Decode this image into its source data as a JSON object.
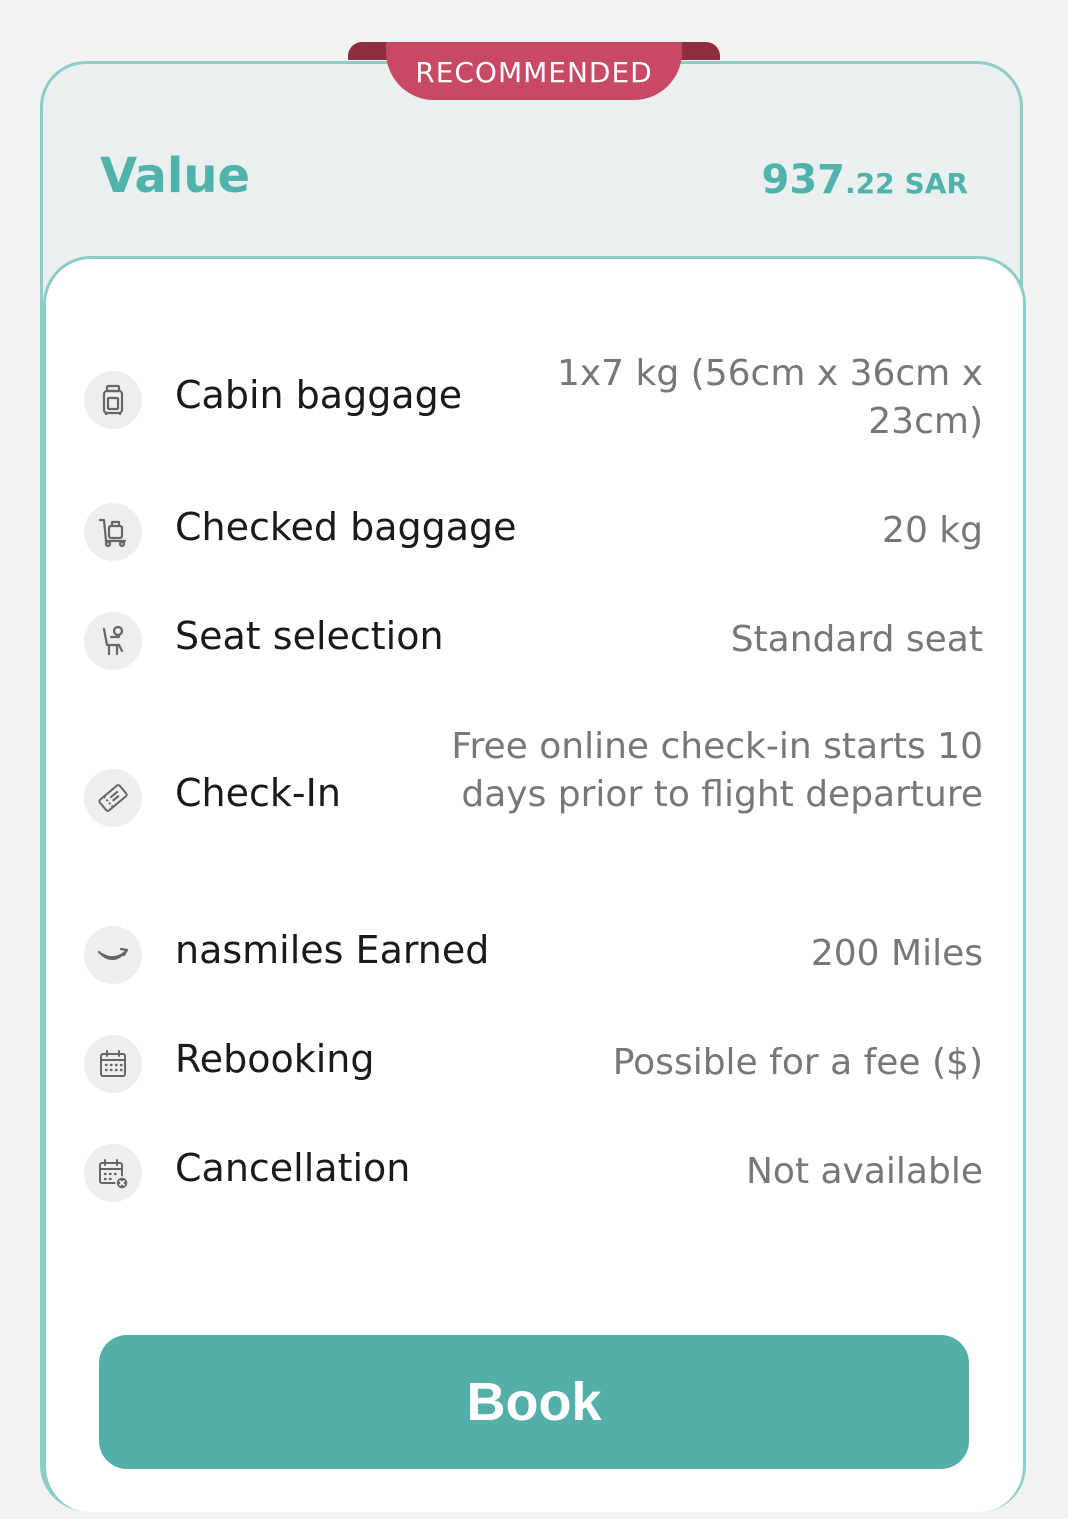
{
  "badge": "RECOMMENDED",
  "fare": {
    "name": "Value",
    "price_int": "937",
    "price_dec": ".22",
    "currency": "SAR"
  },
  "features": [
    {
      "icon": "carry-on-bag-icon",
      "label": "Cabin baggage",
      "value": "1x7 kg (56cm x 36cm x 23cm)"
    },
    {
      "icon": "luggage-cart-icon",
      "label": "Checked baggage",
      "value": "20 kg"
    },
    {
      "icon": "seat-icon",
      "label": "Seat selection",
      "value": "Standard seat"
    },
    {
      "icon": "ticket-icon",
      "label": "Check-In",
      "value": "Free online check-in starts 10 days prior to flight departure"
    },
    {
      "icon": "nasmiles-icon",
      "label": "nasmiles Earned",
      "value": "200 Miles"
    },
    {
      "icon": "calendar-icon",
      "label": "Rebooking",
      "value": "Possible for a fee ($)"
    },
    {
      "icon": "calendar-cancel-icon",
      "label": "Cancellation",
      "value": "Not available"
    }
  ],
  "book_label": "Book",
  "colors": {
    "accent": "#54aea9",
    "badge": "#c84963",
    "border": "#8ccdc8"
  }
}
